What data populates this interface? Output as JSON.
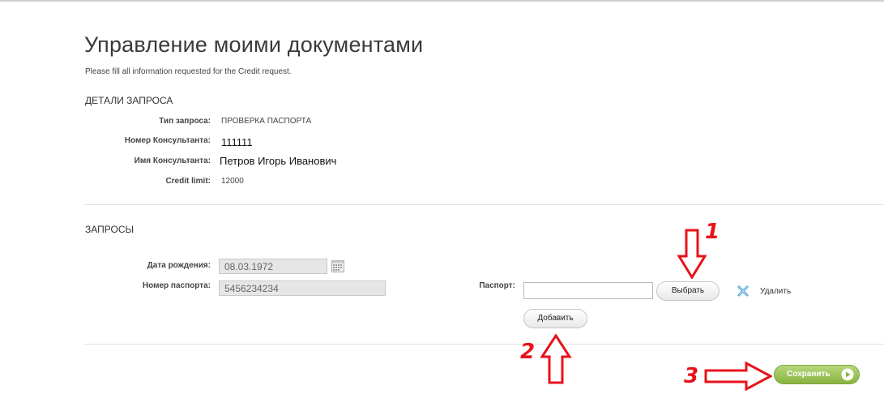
{
  "page": {
    "title": "Управление моими документами",
    "subtitle": "Please fill all information requested for the Credit request."
  },
  "details": {
    "heading": "ДЕТАЛИ ЗАПРОСА",
    "request_type_label": "Тип запроса:",
    "request_type_value": "ПРОВЕРКА ПАСПОРТА",
    "consultant_number_label": "Номер Консультанта:",
    "consultant_number_value": "111111",
    "consultant_name_label": "Имя Консультанта:",
    "consultant_name_value": "Петров Игорь Иванович",
    "credit_limit_label": "Credit limit:",
    "credit_limit_value": "12000"
  },
  "requests": {
    "heading": "ЗАПРОСЫ",
    "birth_date_label": "Дата рождения:",
    "birth_date_value": "08.03.1972",
    "passport_number_label": "Номер паспорта:",
    "passport_number_value": "5456234234",
    "passport_label": "Паспорт:",
    "choose_button": "Выбрать",
    "delete_label": "Удалить",
    "add_button": "Добавить"
  },
  "footer": {
    "save_button": "Сохранить"
  },
  "annotations": {
    "marker_1": "1",
    "marker_2": "2",
    "marker_3": "3",
    "color": "#e8121b"
  },
  "icons": {
    "calendar": "calendar-icon",
    "delete": "delete-x-icon",
    "save": "play-circle-icon"
  },
  "colors": {
    "save_button": "#9cc55a",
    "field_background": "#e6e6e6",
    "annotation": "#e8121b"
  }
}
